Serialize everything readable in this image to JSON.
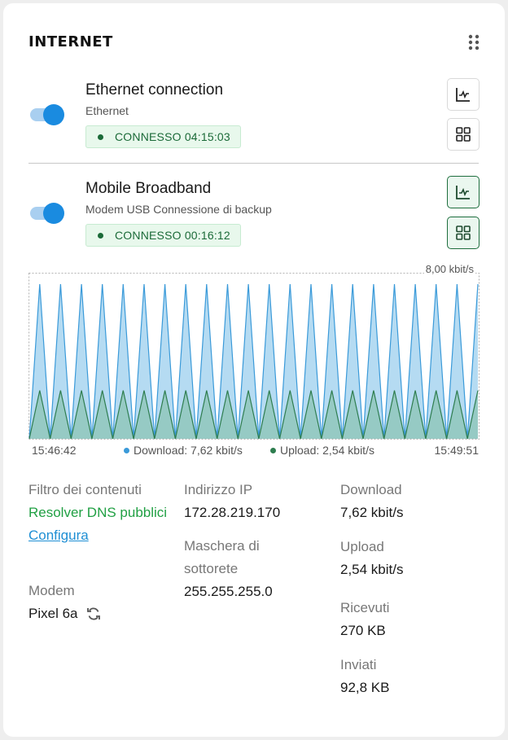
{
  "widget": {
    "title": "INTERNET"
  },
  "connections": [
    {
      "name": "Ethernet connection",
      "subtitle": "Ethernet",
      "status": "CONNESSO 04:15:03",
      "enabled": true
    },
    {
      "name": "Mobile Broadband",
      "subtitle": "Modem USB Connessione di backup",
      "status": "CONNESSO 00:16:12",
      "enabled": true
    }
  ],
  "traffic": {
    "max_label": "8,00 kbit/s",
    "time_start": "15:46:42",
    "time_end": "15:49:51",
    "download_legend": "Download: 7,62 kbit/s",
    "upload_legend": "Upload: 2,54 kbit/s",
    "download_color": "#3a9ad9",
    "upload_color": "#2e7d4f"
  },
  "chart_data": {
    "type": "area",
    "y_max": 8.0,
    "series": [
      {
        "name": "Download",
        "values": [
          0,
          8,
          0,
          8,
          0,
          8,
          0,
          8,
          0,
          8,
          0,
          8,
          0,
          8,
          0,
          8,
          0,
          8,
          0,
          8,
          0,
          8,
          0,
          8,
          0,
          8,
          0,
          8,
          0,
          8,
          0,
          8,
          0,
          8,
          0,
          8,
          0,
          8,
          0,
          8,
          0,
          8,
          0,
          8
        ]
      },
      {
        "name": "Upload",
        "values": [
          0,
          2.5,
          0,
          2.5,
          0,
          2.5,
          0,
          2.5,
          0,
          2.5,
          0,
          2.5,
          0,
          2.5,
          0,
          2.5,
          0,
          2.5,
          0,
          2.5,
          0,
          2.5,
          0,
          2.5,
          0,
          2.5,
          0,
          2.5,
          0,
          2.5,
          0,
          2.5,
          0,
          2.5,
          0,
          2.5,
          0,
          2.5,
          0,
          2.5,
          0,
          2.5,
          0,
          2.5
        ]
      }
    ]
  },
  "details": {
    "filter_label": "Filtro dei contenuti",
    "filter_value": "Resolver DNS pubblici",
    "filter_link": "Configura",
    "modem_label": "Modem",
    "modem_value": "Pixel 6a",
    "ip_label": "Indirizzo IP",
    "ip_value": "172.28.219.170",
    "mask_label": "Maschera di sottorete",
    "mask_value": "255.255.255.0",
    "download_label": "Download",
    "download_value": "7,62 kbit/s",
    "upload_label": "Upload",
    "upload_value": "2,54 kbit/s",
    "received_label": "Ricevuti",
    "received_value": "270 KB",
    "sent_label": "Inviati",
    "sent_value": "92,8 KB"
  }
}
